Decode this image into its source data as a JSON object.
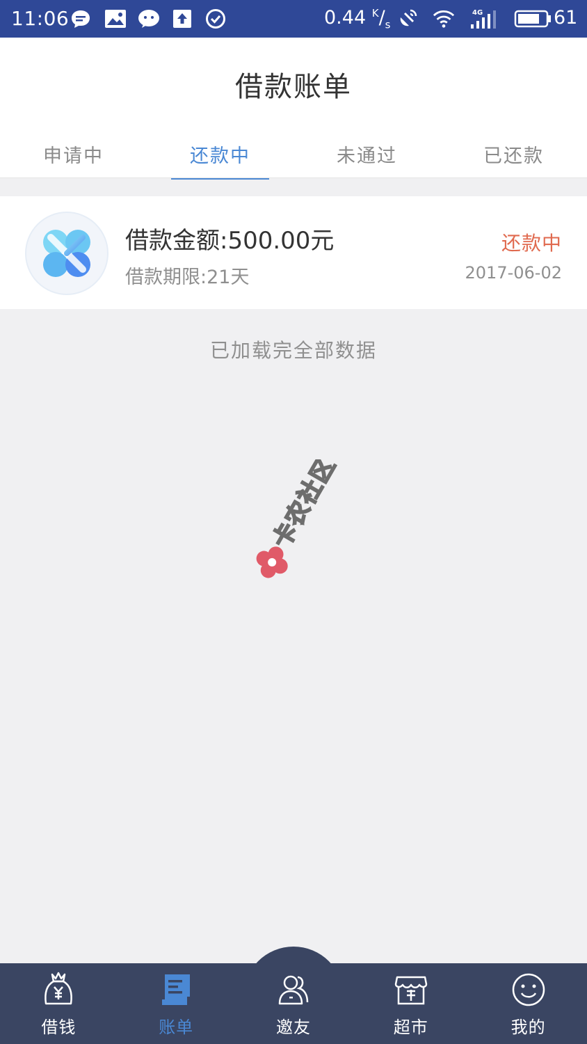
{
  "status_bar": {
    "time": "11:06",
    "speed": "0.44",
    "speed_unit_top": "K",
    "speed_unit_bottom": "s",
    "network": "4G",
    "battery": "61"
  },
  "header": {
    "title": "借款账单",
    "tabs": [
      "申请中",
      "还款中",
      "未通过",
      "已还款"
    ],
    "active_tab_index": 1
  },
  "bill": {
    "amount": "借款金额:500.00元",
    "period": "借款期限:21天",
    "status": "还款中",
    "date": "2017-06-02"
  },
  "list_footer": "已加载完全部数据",
  "watermark": "卡农社区",
  "bottom_nav": {
    "items": [
      {
        "label": "借钱",
        "icon": "money-bag-icon"
      },
      {
        "label": "账单",
        "icon": "bill-scroll-icon"
      },
      {
        "label": "邀友",
        "icon": "invite-friends-icon"
      },
      {
        "label": "超市",
        "icon": "store-icon"
      },
      {
        "label": "我的",
        "icon": "smiley-icon"
      }
    ],
    "active_index": 1
  },
  "colors": {
    "status_bar": "#2f4897",
    "accent": "#4a88d4",
    "status_text": "#e06a4f",
    "nav_bg": "#3a4562"
  }
}
